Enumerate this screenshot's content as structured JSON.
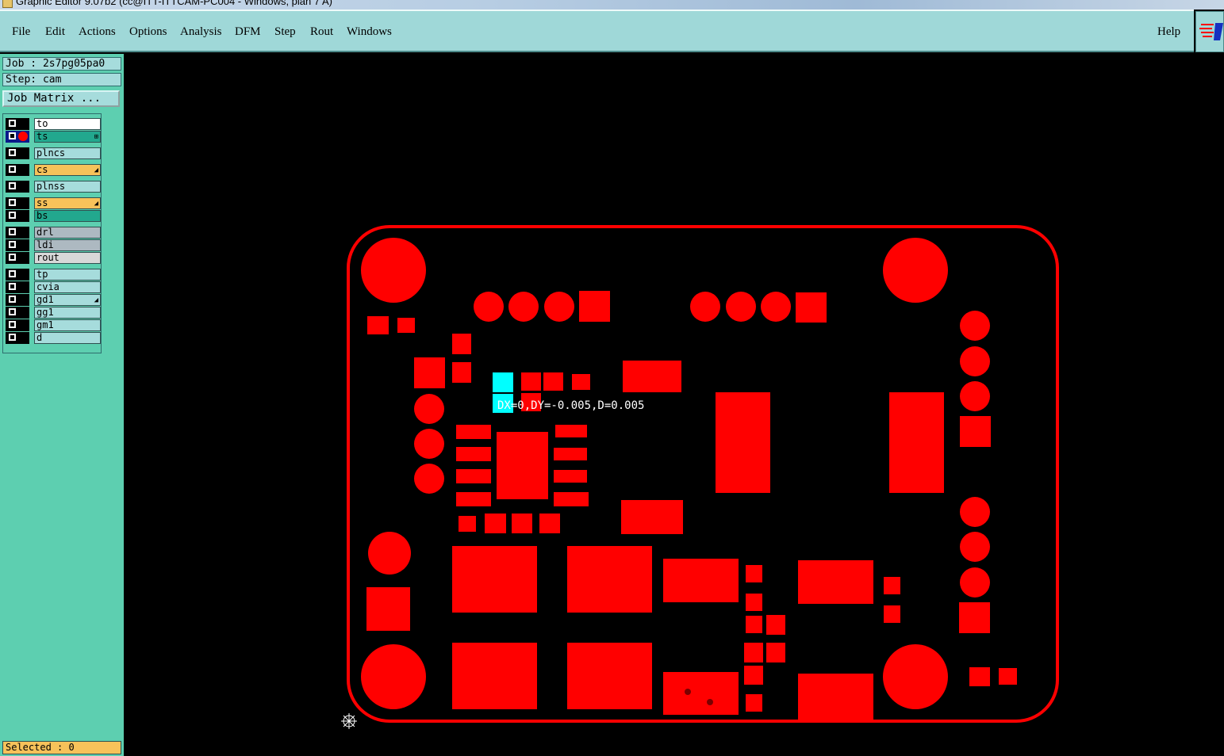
{
  "title_bar": {
    "text": "Graphic Editor 9.07b2 (cc@ITT-ITTCAM-PC004 - Windows, plan 7 A)"
  },
  "menu": {
    "items": [
      "File",
      "Edit",
      "Actions",
      "Options",
      "Analysis",
      "DFM",
      "Step",
      "Rout",
      "Windows"
    ],
    "help": "Help"
  },
  "job": {
    "job": "Job : 2s7pg05pa0",
    "step": "Step: cam",
    "matrix_button": "Job Matrix ..."
  },
  "layers": [
    {
      "name": "to",
      "color": "white"
    },
    {
      "name": "ts",
      "color": "teal",
      "active": true
    },
    {
      "name": "plncs",
      "color": "light"
    },
    {
      "name": "cs",
      "color": "orange",
      "marker": "arrow"
    },
    {
      "name": "plnss",
      "color": "light"
    },
    {
      "name": "ss",
      "color": "orange",
      "marker": "arrow"
    },
    {
      "name": "bs",
      "color": "teal"
    },
    {
      "name": "drl",
      "color": "grey"
    },
    {
      "name": "ldi",
      "color": "grey"
    },
    {
      "name": "rout",
      "color": "lgrey"
    },
    {
      "name": "tp",
      "color": "light"
    },
    {
      "name": "cvia",
      "color": "light"
    },
    {
      "name": "gd1",
      "color": "light",
      "marker": "arrow"
    },
    {
      "name": "gg1",
      "color": "light"
    },
    {
      "name": "gm1",
      "color": "light"
    },
    {
      "name": "d",
      "color": "light"
    }
  ],
  "status": {
    "selected": "Selected : 0"
  },
  "measurement": {
    "text": "DX=0,DY=-0.005,D=0.005"
  },
  "colors": {
    "pad": "#ff0000",
    "highlight": "#00ffff",
    "background": "#000000",
    "panel": "#5dcfb0",
    "menubar": "#9fd8d8"
  }
}
